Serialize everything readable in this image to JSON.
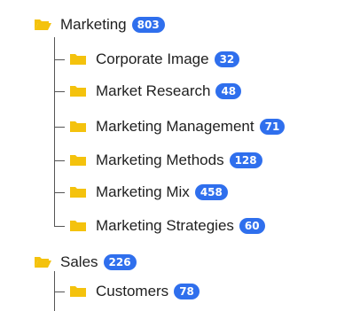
{
  "colors": {
    "folder": "#f4c20d",
    "badge": "#2f6fed",
    "connector": "#555555"
  },
  "tree": {
    "groups": [
      {
        "label": "Marketing",
        "count": "803",
        "icon": "folder-open-icon",
        "children": [
          {
            "label": "Corporate Image",
            "count": "32",
            "icon": "folder-icon"
          },
          {
            "label": "Market Research",
            "count": "48",
            "icon": "folder-icon"
          },
          {
            "label": "Marketing Management",
            "count": "71",
            "icon": "folder-icon"
          },
          {
            "label": "Marketing Methods",
            "count": "128",
            "icon": "folder-icon"
          },
          {
            "label": "Marketing Mix",
            "count": "458",
            "icon": "folder-icon"
          },
          {
            "label": "Marketing Strategies",
            "count": "60",
            "icon": "folder-icon"
          }
        ]
      },
      {
        "label": "Sales",
        "count": "226",
        "icon": "folder-open-icon",
        "children": [
          {
            "label": "Customers",
            "count": "78",
            "icon": "folder-icon"
          }
        ]
      }
    ]
  }
}
